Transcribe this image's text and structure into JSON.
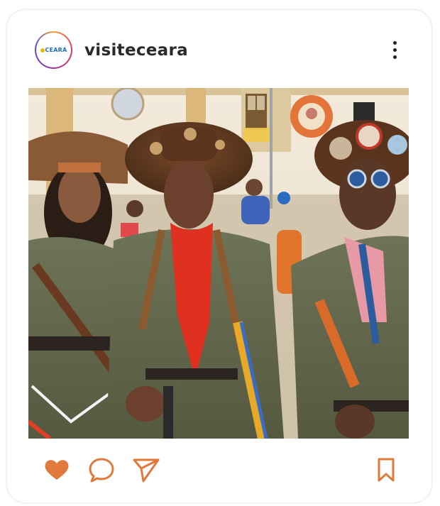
{
  "post": {
    "username": "visiteceara",
    "avatar": {
      "logo_text": "CEARÁ",
      "icon": "ceara-logo-icon"
    },
    "menu_icon": "more-vertical-icon",
    "photo": {
      "icon": "post-photo-image"
    }
  },
  "actions": {
    "like_icon": "heart-icon",
    "comment_icon": "comment-icon",
    "share_icon": "send-icon",
    "save_icon": "bookmark-icon",
    "accent_color": "#e07a3c"
  }
}
